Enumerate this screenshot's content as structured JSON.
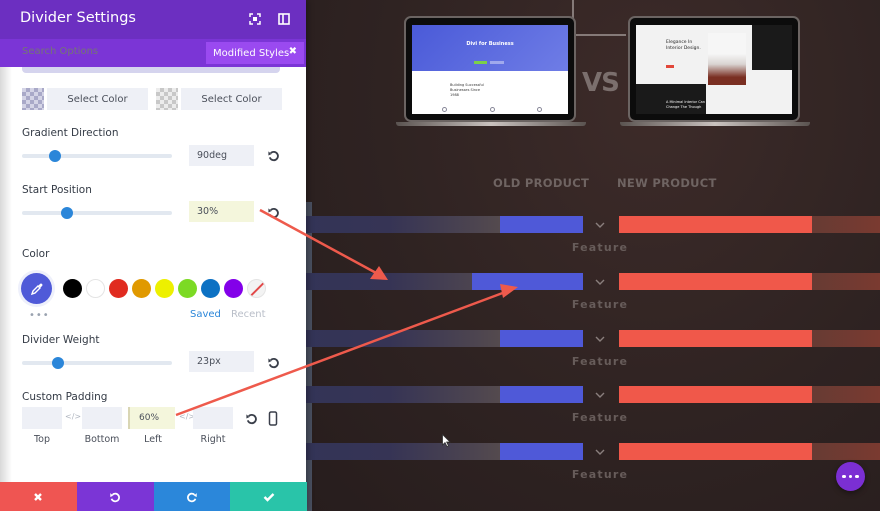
{
  "panel": {
    "title": "Divider Settings",
    "search_placeholder": "Search Options",
    "modified_styles_label": "Modified Styles",
    "select_color_1": "Select Color",
    "select_color_2": "Select Color",
    "gradient_direction": {
      "label": "Gradient Direction",
      "value": "90deg",
      "slider_percent": 22
    },
    "start_position": {
      "label": "Start Position",
      "value": "30%",
      "slider_percent": 30
    },
    "color": {
      "label": "Color",
      "picker_color": "#4f5ad8",
      "swatches": [
        "#000000",
        "#ffffff",
        "#e02b20",
        "#e09900",
        "#edf000",
        "#7cda24",
        "#0c71c3",
        "#8300e9",
        "none"
      ],
      "tab_saved": "Saved",
      "tab_recent": "Recent",
      "more": "•••"
    },
    "divider_weight": {
      "label": "Divider Weight",
      "value": "23px",
      "slider_percent": 24
    },
    "custom_padding": {
      "label": "Custom Padding",
      "top": {
        "label": "Top",
        "value": ""
      },
      "bottom": {
        "label": "Bottom",
        "value": ""
      },
      "left": {
        "label": "Left",
        "value": "60%"
      },
      "right": {
        "label": "Right",
        "value": ""
      }
    },
    "footer": {
      "cancel_color": "#ef5552",
      "undo_color": "#7b35d6",
      "redo_color": "#2b87da",
      "save_color": "#29c4a9"
    }
  },
  "canvas": {
    "old_laptop": {
      "hero_title": "Divi for Business",
      "sub_text": "Building Successful Businesses Since 1988"
    },
    "new_laptop": {
      "title": "Elegance In Interior Design.",
      "caption": "A Minimal Interior Can Change The Though"
    },
    "vs_label": "VS",
    "old_product_label": "OLD PRODUCT",
    "new_product_label": "NEW PRODUCT",
    "rows": [
      {
        "feature": "Feature",
        "old_fill_percent": 30
      },
      {
        "feature": "Feature",
        "old_fill_percent": 40
      },
      {
        "feature": "Feature",
        "old_fill_percent": 30
      },
      {
        "feature": "Feature",
        "old_fill_percent": 30
      },
      {
        "feature": "Feature",
        "old_fill_percent": 30
      }
    ],
    "old_bar_color": "#4f59d8",
    "new_bar_color": "#f0584a"
  }
}
